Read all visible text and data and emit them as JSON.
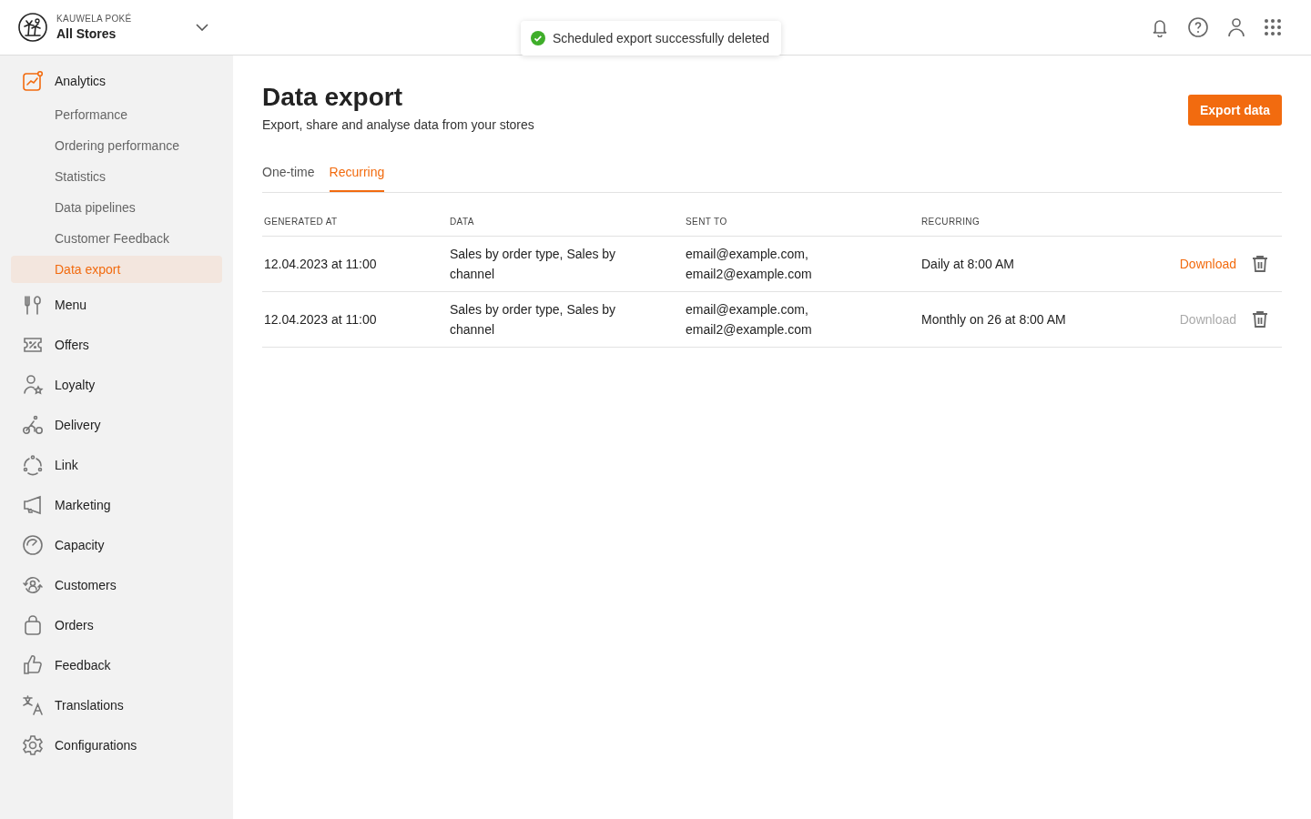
{
  "header": {
    "brand": "KAUWELA POKÉ",
    "store": "All Stores"
  },
  "toast": {
    "message": "Scheduled export successfully deleted"
  },
  "sidebar": {
    "items": [
      {
        "label": "Analytics",
        "expanded": true,
        "selected": false,
        "children": [
          {
            "label": "Performance",
            "selected": false
          },
          {
            "label": "Ordering performance",
            "selected": false
          },
          {
            "label": "Statistics",
            "selected": false
          },
          {
            "label": "Data pipelines",
            "selected": false
          },
          {
            "label": "Customer Feedback",
            "selected": false
          },
          {
            "label": "Data export",
            "selected": true
          }
        ]
      },
      {
        "label": "Menu",
        "selected": false
      },
      {
        "label": "Offers",
        "selected": false
      },
      {
        "label": "Loyalty",
        "selected": false
      },
      {
        "label": "Delivery",
        "selected": false
      },
      {
        "label": "Link",
        "selected": false
      },
      {
        "label": "Marketing",
        "selected": false
      },
      {
        "label": "Capacity",
        "selected": false
      },
      {
        "label": "Customers",
        "selected": false
      },
      {
        "label": "Orders",
        "selected": false
      },
      {
        "label": "Feedback",
        "selected": false
      },
      {
        "label": "Translations",
        "selected": false
      },
      {
        "label": "Configurations",
        "selected": false
      }
    ]
  },
  "page": {
    "title": "Data export",
    "subtitle": "Export, share and analyse data from your stores",
    "action": "Export data"
  },
  "tabs": [
    {
      "label": "One-time",
      "selected": false
    },
    {
      "label": "Recurring",
      "selected": true
    }
  ],
  "table": {
    "columns": [
      "GENERATED AT",
      "DATA",
      "SENT TO",
      "RECURRING"
    ],
    "rows": [
      {
        "generated_at": "12.04.2023 at 11:00",
        "data": "Sales by order type, Sales by channel",
        "sent_to": "email@example.com, email2@example.com",
        "recurring": "Daily at 8:00 AM",
        "download": "Download",
        "disabled": false
      },
      {
        "generated_at": "12.04.2023 at 11:00",
        "data": "Sales by order type, Sales by channel",
        "sent_to": "email@example.com, email2@example.com",
        "recurring": "Monthly on 26 at 8:00 AM",
        "download": "Download",
        "disabled": true
      }
    ]
  }
}
